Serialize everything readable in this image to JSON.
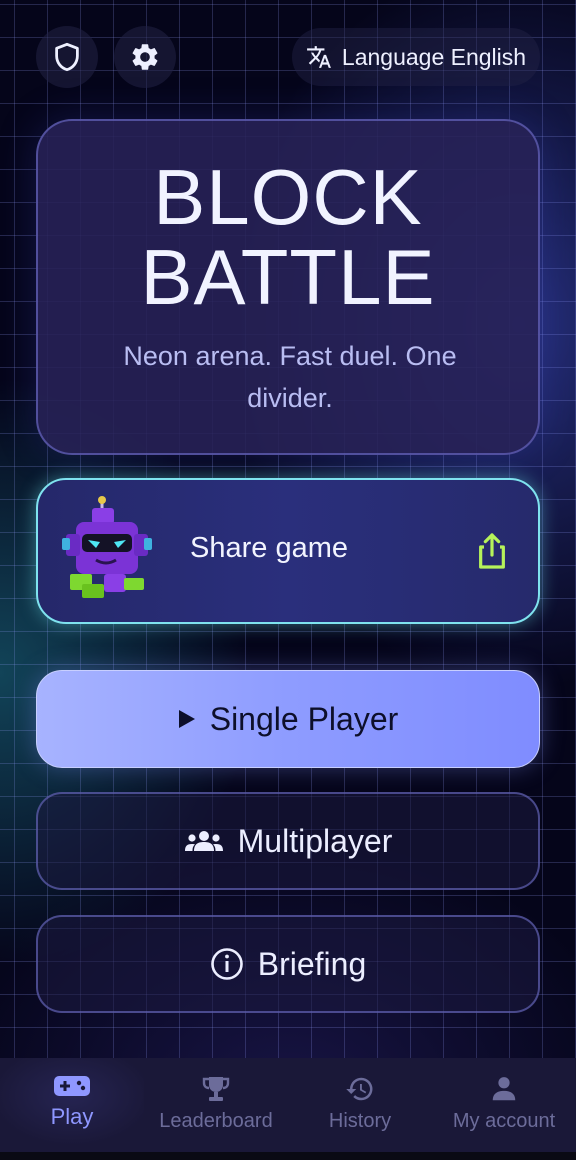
{
  "header": {
    "shield_icon": "shield-icon",
    "settings_icon": "gear-icon",
    "language_label": "Language English"
  },
  "hero": {
    "title": "BLOCK\nBATTLE",
    "subtitle": "Neon arena. Fast duel. One divider."
  },
  "share": {
    "label": "Share game",
    "icon": "share-icon"
  },
  "buttons": {
    "single": "Single Player",
    "multi": "Multiplayer",
    "briefing": "Briefing"
  },
  "nav": [
    {
      "label": "Play",
      "icon": "gamepad-icon",
      "active": true
    },
    {
      "label": "Leaderboard",
      "icon": "trophy-icon",
      "active": false
    },
    {
      "label": "History",
      "icon": "history-icon",
      "active": false
    },
    {
      "label": "My account",
      "icon": "person-icon",
      "active": false
    }
  ],
  "colors": {
    "accent": "#8f97ff",
    "share_border": "#7fe3ef",
    "share_icon": "#b6f35a"
  }
}
